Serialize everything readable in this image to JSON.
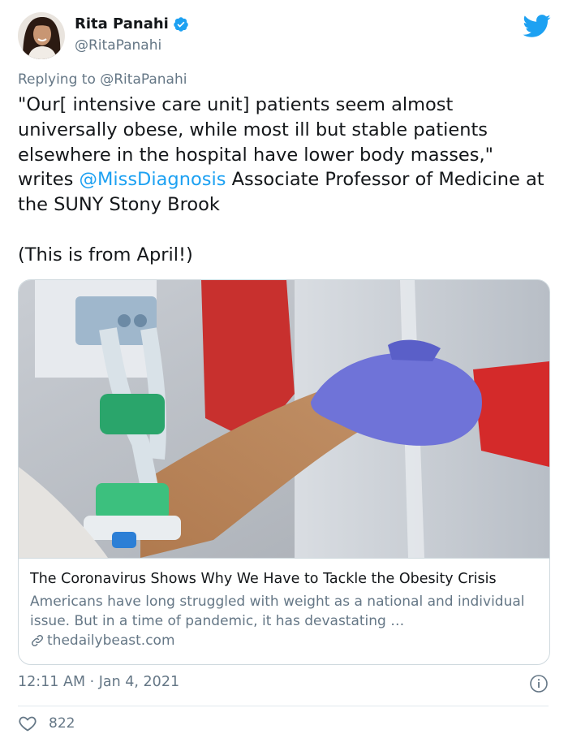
{
  "author": {
    "name": "Rita Panahi",
    "handle": "@RitaPanahi",
    "avatar_icon": "avatar-photo",
    "verified_icon": "verified-badge-icon"
  },
  "reply": {
    "prefix": "Replying to ",
    "mention": "@RitaPanahi"
  },
  "tweet": {
    "text_before_mention": "\"Our[ intensive care unit] patients seem almost universally obese, while most ill but stable patients elsewhere in the hospital have lower body masses,\" writes ",
    "mention": "@MissDiagnosis",
    "text_after_mention": " Associate Professor of Medicine at the SUNY Stony Brook\n\n(This is from April!)"
  },
  "card": {
    "title": "The Coronavirus Shows Why We Have to Tackle the Obesity Crisis",
    "description": "Americans have long struggled with weight as a national and individual issue. But in a time of pandemic, it has devastating …",
    "domain": "thedailybeast.com",
    "image_icon": "hospital-hand-holding-photo"
  },
  "meta": {
    "timestamp": "12:11 AM · Jan 4, 2021"
  },
  "engagement": {
    "likes": "822"
  },
  "colors": {
    "accent": "#1da1f2",
    "secondary_text": "#657786",
    "border": "#cfd9de"
  }
}
